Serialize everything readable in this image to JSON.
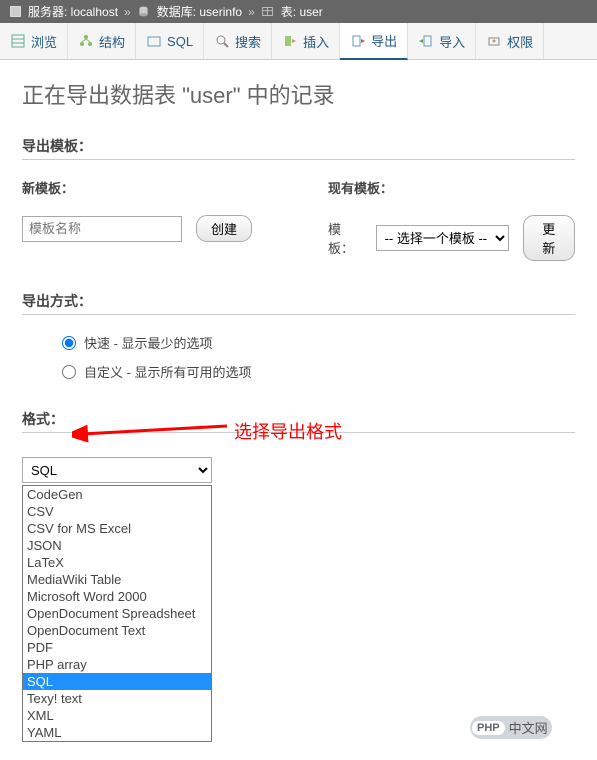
{
  "breadcrumb": {
    "server_label": "服务器: localhost",
    "db_label": "数据库: userinfo",
    "table_label": "表: user",
    "sep": "»"
  },
  "tabs": [
    {
      "label": "浏览"
    },
    {
      "label": "结构"
    },
    {
      "label": "SQL"
    },
    {
      "label": "搜索"
    },
    {
      "label": "插入"
    },
    {
      "label": "导出"
    },
    {
      "label": "导入"
    },
    {
      "label": "权限"
    }
  ],
  "page_title": "正在导出数据表 \"user\" 中的记录",
  "export_template": {
    "heading": "导出模板：",
    "new_template_label": "新模板：",
    "new_template_placeholder": "模板名称",
    "create_button": "创建",
    "existing_template_label": "现有模板：",
    "template_field_label": "模板：",
    "template_select_placeholder": "-- 选择一个模板 --",
    "update_button": "更新"
  },
  "export_method": {
    "heading": "导出方式：",
    "quick": "快速 - 显示最少的选项",
    "custom": "自定义 - 显示所有可用的选项"
  },
  "format_section": {
    "heading": "格式：",
    "selected": "SQL",
    "options": [
      "CodeGen",
      "CSV",
      "CSV for MS Excel",
      "JSON",
      "LaTeX",
      "MediaWiki Table",
      "Microsoft Word 2000",
      "OpenDocument Spreadsheet",
      "OpenDocument Text",
      "PDF",
      "PHP array",
      "SQL",
      "Texy! text",
      "XML",
      "YAML"
    ]
  },
  "annotation": {
    "text": "选择导出格式"
  },
  "watermark": {
    "badge": "PHP",
    "text": "中文网"
  }
}
